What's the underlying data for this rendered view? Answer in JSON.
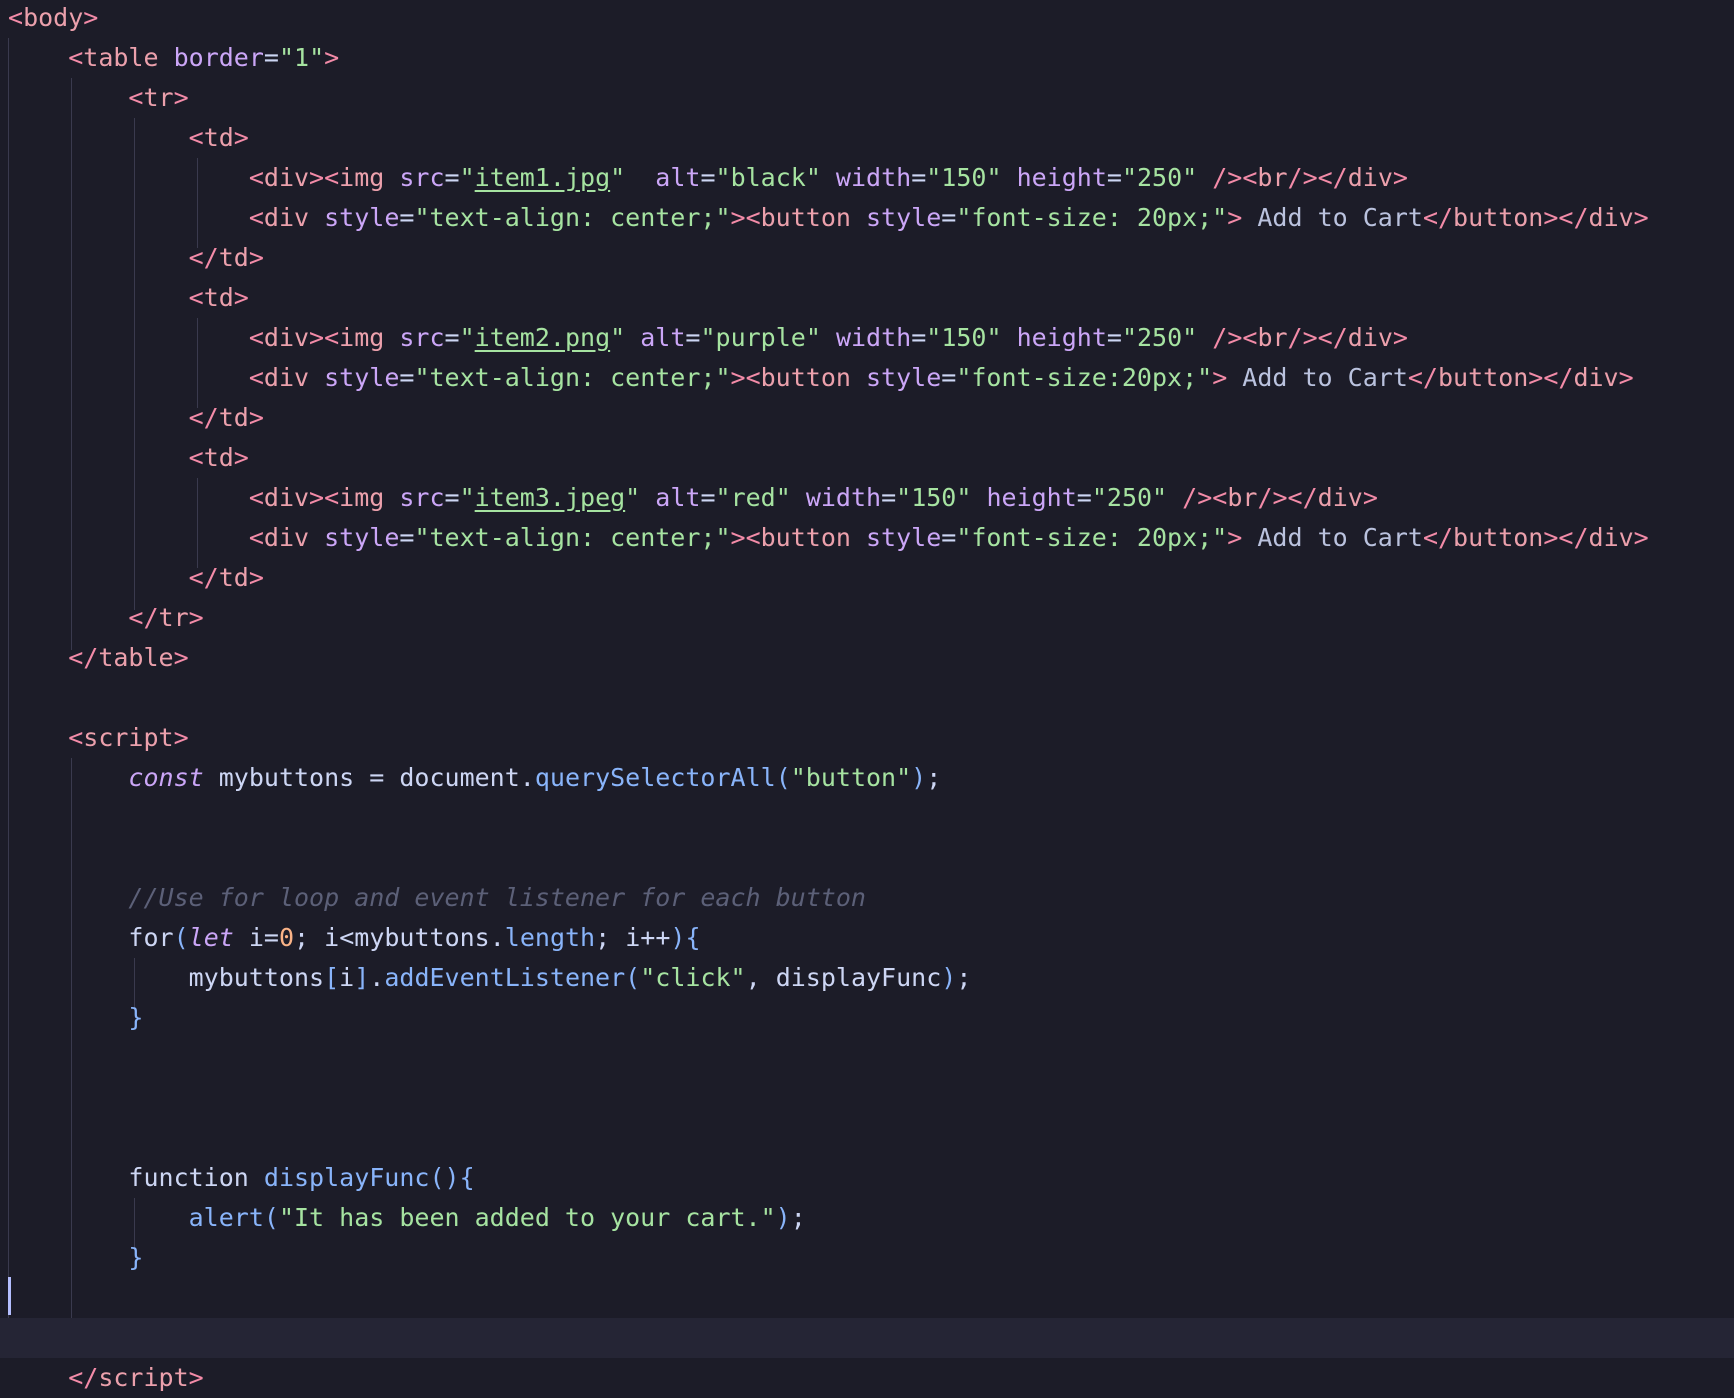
{
  "editor": {
    "colors": {
      "background": "#1c1c28",
      "tag": "#eba0ac",
      "punctuation": "#f38ba8",
      "attribute": "#cba6f7",
      "string": "#a6e3a1",
      "keyword": "#cba6f7",
      "function": "#89b4fa",
      "number": "#fab387",
      "comment": "#5c6078",
      "text": "#cdd6f4"
    },
    "cursor_line": 33,
    "lines": [
      [
        [
          "t-punc",
          "<"
        ],
        [
          "t-tag",
          "body"
        ],
        [
          "t-punc",
          ">"
        ]
      ],
      [
        [
          "",
          "    "
        ],
        [
          "t-punc",
          "<"
        ],
        [
          "t-tag",
          "table "
        ],
        [
          "t-attr",
          "border"
        ],
        [
          "t-op",
          "="
        ],
        [
          "t-str",
          "\"1\""
        ],
        [
          "t-punc",
          ">"
        ]
      ],
      [
        [
          "",
          "        "
        ],
        [
          "t-punc",
          "<"
        ],
        [
          "t-tag",
          "tr"
        ],
        [
          "t-punc",
          ">"
        ]
      ],
      [
        [
          "",
          "            "
        ],
        [
          "t-punc",
          "<"
        ],
        [
          "t-tag",
          "td"
        ],
        [
          "t-punc",
          ">"
        ]
      ],
      [
        [
          "",
          "                "
        ],
        [
          "t-punc",
          "<"
        ],
        [
          "t-tag",
          "div"
        ],
        [
          "t-punc",
          "><"
        ],
        [
          "t-tag",
          "img "
        ],
        [
          "t-attr",
          "src"
        ],
        [
          "t-op",
          "="
        ],
        [
          "t-str",
          "\""
        ],
        [
          "t-link",
          "item1.jpg"
        ],
        [
          "t-str",
          "\""
        ],
        [
          "",
          "  "
        ],
        [
          "t-attr",
          "alt"
        ],
        [
          "t-op",
          "="
        ],
        [
          "t-str",
          "\"black\""
        ],
        [
          "",
          ""
        ],
        [
          "t-attr",
          " width"
        ],
        [
          "t-op",
          "="
        ],
        [
          "t-str",
          "\"150\""
        ],
        [
          "t-attr",
          " height"
        ],
        [
          "t-op",
          "="
        ],
        [
          "t-str",
          "\"250\""
        ],
        [
          "t-punc",
          " /><"
        ],
        [
          "t-tag",
          "br"
        ],
        [
          "t-punc",
          "/></"
        ],
        [
          "t-tag",
          "div"
        ],
        [
          "t-punc",
          ">"
        ]
      ],
      [
        [
          "",
          "                "
        ],
        [
          "t-punc",
          "<"
        ],
        [
          "t-tag",
          "div "
        ],
        [
          "t-attr",
          "style"
        ],
        [
          "t-op",
          "="
        ],
        [
          "t-str",
          "\"text-align: center;\""
        ],
        [
          "t-punc",
          "><"
        ],
        [
          "t-tag",
          "button "
        ],
        [
          "t-attr",
          "style"
        ],
        [
          "t-op",
          "="
        ],
        [
          "t-str",
          "\"font-size: 20px;\""
        ],
        [
          "t-punc",
          ">"
        ],
        [
          "t-text",
          " Add to Cart"
        ],
        [
          "t-punc",
          "</"
        ],
        [
          "t-tag",
          "button"
        ],
        [
          "t-punc",
          "></"
        ],
        [
          "t-tag",
          "div"
        ],
        [
          "t-punc",
          ">"
        ]
      ],
      [
        [
          "",
          "            "
        ],
        [
          "t-punc",
          "</"
        ],
        [
          "t-tag",
          "td"
        ],
        [
          "t-punc",
          ">"
        ]
      ],
      [
        [
          "",
          "            "
        ],
        [
          "t-punc",
          "<"
        ],
        [
          "t-tag",
          "td"
        ],
        [
          "t-punc",
          ">"
        ]
      ],
      [
        [
          "",
          "                "
        ],
        [
          "t-punc",
          "<"
        ],
        [
          "t-tag",
          "div"
        ],
        [
          "t-punc",
          "><"
        ],
        [
          "t-tag",
          "img "
        ],
        [
          "t-attr",
          "src"
        ],
        [
          "t-op",
          "="
        ],
        [
          "t-str",
          "\""
        ],
        [
          "t-link",
          "item2.png"
        ],
        [
          "t-str",
          "\""
        ],
        [
          "t-attr",
          " alt"
        ],
        [
          "t-op",
          "="
        ],
        [
          "t-str",
          "\"purple\""
        ],
        [
          "t-attr",
          " width"
        ],
        [
          "t-op",
          "="
        ],
        [
          "t-str",
          "\"150\""
        ],
        [
          "t-attr",
          " height"
        ],
        [
          "t-op",
          "="
        ],
        [
          "t-str",
          "\"250\""
        ],
        [
          "t-punc",
          " /><"
        ],
        [
          "t-tag",
          "br"
        ],
        [
          "t-punc",
          "/></"
        ],
        [
          "t-tag",
          "div"
        ],
        [
          "t-punc",
          ">"
        ]
      ],
      [
        [
          "",
          "                "
        ],
        [
          "t-punc",
          "<"
        ],
        [
          "t-tag",
          "div "
        ],
        [
          "t-attr",
          "style"
        ],
        [
          "t-op",
          "="
        ],
        [
          "t-str",
          "\"text-align: center;\""
        ],
        [
          "t-punc",
          "><"
        ],
        [
          "t-tag",
          "button "
        ],
        [
          "t-attr",
          "style"
        ],
        [
          "t-op",
          "="
        ],
        [
          "t-str",
          "\"font-size:20px;\""
        ],
        [
          "t-punc",
          ">"
        ],
        [
          "t-text",
          " Add to Cart"
        ],
        [
          "t-punc",
          "</"
        ],
        [
          "t-tag",
          "button"
        ],
        [
          "t-punc",
          "></"
        ],
        [
          "t-tag",
          "div"
        ],
        [
          "t-punc",
          ">"
        ]
      ],
      [
        [
          "",
          "            "
        ],
        [
          "t-punc",
          "</"
        ],
        [
          "t-tag",
          "td"
        ],
        [
          "t-punc",
          ">"
        ]
      ],
      [
        [
          "",
          "            "
        ],
        [
          "t-punc",
          "<"
        ],
        [
          "t-tag",
          "td"
        ],
        [
          "t-punc",
          ">"
        ]
      ],
      [
        [
          "",
          "                "
        ],
        [
          "t-punc",
          "<"
        ],
        [
          "t-tag",
          "div"
        ],
        [
          "t-punc",
          "><"
        ],
        [
          "t-tag",
          "img "
        ],
        [
          "t-attr",
          "src"
        ],
        [
          "t-op",
          "="
        ],
        [
          "t-str",
          "\""
        ],
        [
          "t-link",
          "item3.jpeg"
        ],
        [
          "t-str",
          "\""
        ],
        [
          "t-attr",
          " alt"
        ],
        [
          "t-op",
          "="
        ],
        [
          "t-str",
          "\"red\""
        ],
        [
          "t-attr",
          " width"
        ],
        [
          "t-op",
          "="
        ],
        [
          "t-str",
          "\"150\""
        ],
        [
          "t-attr",
          " height"
        ],
        [
          "t-op",
          "="
        ],
        [
          "t-str",
          "\"250\""
        ],
        [
          "t-punc",
          " /><"
        ],
        [
          "t-tag",
          "br"
        ],
        [
          "t-punc",
          "/></"
        ],
        [
          "t-tag",
          "div"
        ],
        [
          "t-punc",
          ">"
        ]
      ],
      [
        [
          "",
          "                "
        ],
        [
          "t-punc",
          "<"
        ],
        [
          "t-tag",
          "div "
        ],
        [
          "t-attr",
          "style"
        ],
        [
          "t-op",
          "="
        ],
        [
          "t-str",
          "\"text-align: center;\""
        ],
        [
          "t-punc",
          "><"
        ],
        [
          "t-tag",
          "button "
        ],
        [
          "t-attr",
          "style"
        ],
        [
          "t-op",
          "="
        ],
        [
          "t-str",
          "\"font-size: 20px;\""
        ],
        [
          "t-punc",
          ">"
        ],
        [
          "t-text",
          " Add to Cart"
        ],
        [
          "t-punc",
          "</"
        ],
        [
          "t-tag",
          "button"
        ],
        [
          "t-punc",
          "></"
        ],
        [
          "t-tag",
          "div"
        ],
        [
          "t-punc",
          ">"
        ]
      ],
      [
        [
          "",
          "            "
        ],
        [
          "t-punc",
          "</"
        ],
        [
          "t-tag",
          "td"
        ],
        [
          "t-punc",
          ">"
        ]
      ],
      [
        [
          "",
          "        "
        ],
        [
          "t-punc",
          "</"
        ],
        [
          "t-tag",
          "tr"
        ],
        [
          "t-punc",
          ">"
        ]
      ],
      [
        [
          "",
          "    "
        ],
        [
          "t-punc",
          "</"
        ],
        [
          "t-tag",
          "table"
        ],
        [
          "t-punc",
          ">"
        ]
      ],
      [
        [
          "",
          ""
        ]
      ],
      [
        [
          "",
          "    "
        ],
        [
          "t-punc",
          "<"
        ],
        [
          "t-tag",
          "script"
        ],
        [
          "t-punc",
          ">"
        ]
      ],
      [
        [
          "",
          "        "
        ],
        [
          "t-kw",
          "const"
        ],
        [
          "t-var",
          " mybuttons "
        ],
        [
          "t-op",
          "= "
        ],
        [
          "t-var",
          "document"
        ],
        [
          "t-op",
          "."
        ],
        [
          "t-fn",
          "querySelectorAll"
        ],
        [
          "t-paren",
          "("
        ],
        [
          "t-str",
          "\"button\""
        ],
        [
          "t-paren",
          ")"
        ],
        [
          "t-op",
          ";"
        ]
      ],
      [
        [
          "",
          ""
        ]
      ],
      [
        [
          "",
          ""
        ]
      ],
      [
        [
          "",
          "        "
        ],
        [
          "t-cmt",
          "//Use for loop and event listener for each button"
        ]
      ],
      [
        [
          "",
          "        "
        ],
        [
          "t-ctl",
          "for"
        ],
        [
          "t-paren",
          "("
        ],
        [
          "t-kw",
          "let"
        ],
        [
          "t-var",
          " i"
        ],
        [
          "t-op",
          "="
        ],
        [
          "t-num",
          "0"
        ],
        [
          "t-op",
          "; "
        ],
        [
          "t-var",
          "i"
        ],
        [
          "t-op",
          "<"
        ],
        [
          "t-var",
          "mybuttons"
        ],
        [
          "t-op",
          "."
        ],
        [
          "t-prop",
          "length"
        ],
        [
          "t-op",
          "; "
        ],
        [
          "t-var",
          "i"
        ],
        [
          "t-op",
          "++"
        ],
        [
          "t-paren",
          "){"
        ]
      ],
      [
        [
          "",
          "            "
        ],
        [
          "t-var",
          "mybuttons"
        ],
        [
          "t-paren",
          "["
        ],
        [
          "t-var",
          "i"
        ],
        [
          "t-paren",
          "]"
        ],
        [
          "t-op",
          "."
        ],
        [
          "t-fn",
          "addEventListener"
        ],
        [
          "t-paren",
          "("
        ],
        [
          "t-str",
          "\"click\""
        ],
        [
          "t-op",
          ", "
        ],
        [
          "t-var",
          "displayFunc"
        ],
        [
          "t-paren",
          ")"
        ],
        [
          "t-op",
          ";"
        ]
      ],
      [
        [
          "",
          "        "
        ],
        [
          "t-paren",
          "}"
        ]
      ],
      [
        [
          "",
          ""
        ]
      ],
      [
        [
          "",
          ""
        ]
      ],
      [
        [
          "",
          ""
        ]
      ],
      [
        [
          "",
          "        "
        ],
        [
          "t-ctl",
          "function "
        ],
        [
          "t-fn",
          "displayFunc"
        ],
        [
          "t-paren",
          "(){"
        ]
      ],
      [
        [
          "",
          "            "
        ],
        [
          "t-fn",
          "alert"
        ],
        [
          "t-paren",
          "("
        ],
        [
          "t-str",
          "\"It has been added to your cart.\""
        ],
        [
          "t-paren",
          ")"
        ],
        [
          "t-op",
          ";"
        ]
      ],
      [
        [
          "",
          "        "
        ],
        [
          "t-paren",
          "}"
        ]
      ],
      [
        [
          "",
          ""
        ]
      ],
      [
        [
          "",
          ""
        ]
      ],
      [
        [
          "",
          "    "
        ],
        [
          "t-punc",
          "</"
        ],
        [
          "t-tag",
          "script"
        ],
        [
          "t-punc",
          ">"
        ]
      ]
    ]
  }
}
